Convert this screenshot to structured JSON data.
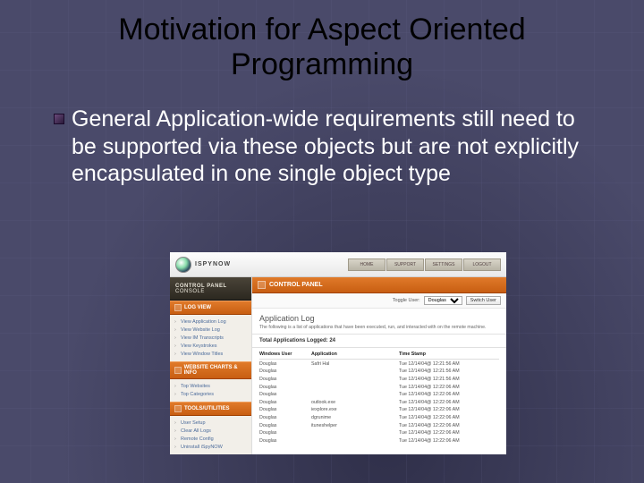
{
  "slide": {
    "title": "Motivation for Aspect Oriented Programming",
    "bullet1": "General Application-wide requirements still need to be supported via these objects but are not explicitly encapsulated in one single object type"
  },
  "screenshot": {
    "brand": "ISPYNOW",
    "console_line1": "CONTROL PANEL",
    "console_line2": "CONSOLE",
    "topnav": [
      "HOME",
      "SUPPORT",
      "SETTINGS",
      "LOGOUT"
    ],
    "sidebar": {
      "groups": [
        {
          "header": "LOG VIEW",
          "items": [
            "View Application Log",
            "View Website Log",
            "View IM Transcripts",
            "View Keystrokes",
            "View Window Titles"
          ]
        },
        {
          "header": "WEBSITE CHARTS & INFO",
          "items": [
            "Top Websites",
            "Top Categories"
          ]
        },
        {
          "header": "TOOLS/UTILITIES",
          "items": [
            "User Setup",
            "Clear All Logs",
            "Remote Config",
            "Uninstall iSpyNOW"
          ]
        }
      ]
    },
    "main": {
      "header": "CONTROL PANEL",
      "toggle_label": "Toggle User:",
      "toggle_value": "Douglas",
      "toggle_button": "Switch User",
      "section_title": "Application Log",
      "description": "The following is a list of applications that have been executed, run, and interacted with on the remote machine.",
      "count_label": "Total Applications Logged: 24",
      "columns": [
        "Windows User",
        "Application",
        "Time Stamp"
      ],
      "rows": [
        {
          "user": "Douglas",
          "app": "Safri Hal",
          "ts": "Tue 12/14/04@ 12:21:56 AM"
        },
        {
          "user": "Douglas",
          "app": "",
          "ts": "Tue 12/14/04@ 12:21:56 AM"
        },
        {
          "user": "Douglas",
          "app": "",
          "ts": "Tue 12/14/04@ 12:21:56 AM"
        },
        {
          "user": "Douglas",
          "app": "",
          "ts": "Tue 12/14/04@ 12:22:06 AM"
        },
        {
          "user": "Douglas",
          "app": "",
          "ts": "Tue 12/14/04@ 12:22:06 AM"
        },
        {
          "user": "Douglas",
          "app": "outlook.exe",
          "ts": "Tue 12/14/04@ 12:22:06 AM"
        },
        {
          "user": "Douglas",
          "app": "iexplore.exe",
          "ts": "Tue 12/14/04@ 12:22:06 AM"
        },
        {
          "user": "Douglas",
          "app": "dgrunime",
          "ts": "Tue 12/14/04@ 12:22:06 AM"
        },
        {
          "user": "Douglas",
          "app": "ituneshelper",
          "ts": "Tue 12/14/04@ 12:22:06 AM"
        },
        {
          "user": "Douglas",
          "app": "",
          "ts": "Tue 12/14/04@ 12:22:06 AM"
        },
        {
          "user": "Douglas",
          "app": "",
          "ts": "Tue 12/14/04@ 12:22:06 AM"
        }
      ]
    }
  }
}
